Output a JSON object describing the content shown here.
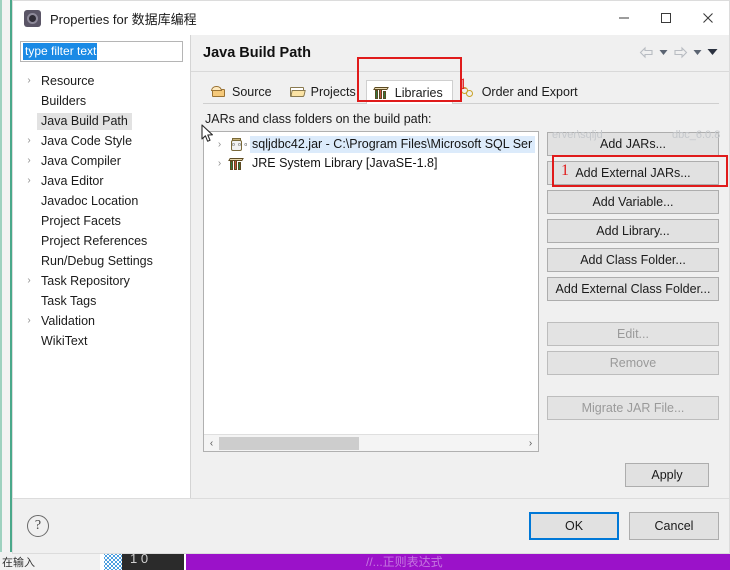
{
  "window": {
    "title": "Properties for 数据库编程",
    "icon": "gear-icon",
    "minimize_label": "—",
    "maximize_label": "□",
    "close_label": "✕"
  },
  "sidebar": {
    "filter": {
      "value": "type filter text",
      "placeholder": "type filter text"
    },
    "items": [
      {
        "label": "Resource",
        "expandable": true,
        "selected": false
      },
      {
        "label": "Builders",
        "expandable": false,
        "selected": false
      },
      {
        "label": "Java Build Path",
        "expandable": false,
        "selected": true
      },
      {
        "label": "Java Code Style",
        "expandable": true,
        "selected": false
      },
      {
        "label": "Java Compiler",
        "expandable": true,
        "selected": false
      },
      {
        "label": "Java Editor",
        "expandable": true,
        "selected": false
      },
      {
        "label": "Javadoc Location",
        "expandable": false,
        "selected": false
      },
      {
        "label": "Project Facets",
        "expandable": false,
        "selected": false
      },
      {
        "label": "Project References",
        "expandable": false,
        "selected": false
      },
      {
        "label": "Run/Debug Settings",
        "expandable": false,
        "selected": false
      },
      {
        "label": "Task Repository",
        "expandable": true,
        "selected": false
      },
      {
        "label": "Task Tags",
        "expandable": false,
        "selected": false
      },
      {
        "label": "Validation",
        "expandable": true,
        "selected": false
      },
      {
        "label": "WikiText",
        "expandable": false,
        "selected": false
      }
    ],
    "expand_arrow": "›"
  },
  "page": {
    "title": "Java Build Path",
    "nav": {
      "back_icon": "back-arrow-icon",
      "back_menu_icon": "chevron-down-icon",
      "forward_icon": "forward-arrow-icon",
      "forward_menu_icon": "chevron-down-icon",
      "view_menu_icon": "chevron-down-icon"
    },
    "tabs": [
      {
        "label": "Source",
        "icon": "package-icon",
        "active": false
      },
      {
        "label": "Projects",
        "icon": "folder-icon",
        "active": false
      },
      {
        "label": "Libraries",
        "icon": "books-icon",
        "active": true
      },
      {
        "label": "Order and Export",
        "icon": "chain-icon",
        "active": false
      }
    ],
    "list_label": "JARs and class folders on the build path:",
    "entries": [
      {
        "label": "sqljdbc42.jar - C:\\Program Files\\Microsoft SQL Ser",
        "icon": "jar-icon",
        "expandable": true,
        "selected": true
      },
      {
        "label": "JRE System Library [JavaSE-1.8]",
        "icon": "library-icon",
        "expandable": true,
        "selected": false
      }
    ],
    "scrollbar": {
      "left_arrow": "‹",
      "right_arrow": "›",
      "thumb_percent": 46
    },
    "buttons": [
      {
        "label": "Add JARs...",
        "enabled": true
      },
      {
        "label": "Add External JARs...",
        "enabled": true
      },
      {
        "label": "Add Variable...",
        "enabled": true
      },
      {
        "label": "Add Library...",
        "enabled": true
      },
      {
        "label": "Add Class Folder...",
        "enabled": true
      },
      {
        "label": "Add External Class Folder...",
        "enabled": true
      }
    ],
    "buttons_secondary": [
      {
        "label": "Edit...",
        "enabled": false
      },
      {
        "label": "Remove",
        "enabled": false
      }
    ],
    "buttons_tertiary": [
      {
        "label": "Migrate JAR File...",
        "enabled": false
      }
    ],
    "apply_label": "Apply",
    "ghost_tooltip_left": "erver\\sqljd",
    "ghost_tooltip_right": "dbc_6.0.8"
  },
  "footer": {
    "help_label": "?",
    "ok_label": "OK",
    "cancel_label": "Cancel"
  },
  "annotations": [
    {
      "number": "1",
      "target": "libraries-tab"
    },
    {
      "number": "1",
      "target": "add-external-jars-button"
    }
  ],
  "colors": {
    "annotation_red": "#e01b1b",
    "focus_blue": "#0078d7",
    "selection_blue": "#1a8ae5",
    "row_selection": "#dcebfb",
    "taskbar_purple": "#9b12c9",
    "background_teal": "#4aa88a"
  },
  "background": {
    "taskbar_text": "在输入",
    "taskbar_number": "1 0",
    "taskbar_app_text": "//...正则表达式"
  }
}
